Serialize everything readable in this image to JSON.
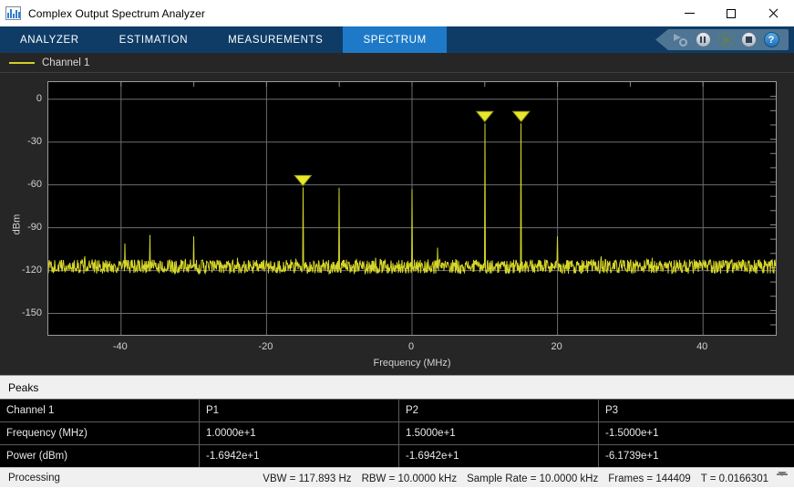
{
  "window": {
    "title": "Complex Output Spectrum Analyzer",
    "icon": "spectrum-bars-icon",
    "minimize_label": "Minimize",
    "maximize_label": "Maximize",
    "close_label": "Close"
  },
  "tabs": [
    {
      "label": "ANALYZER",
      "active": false
    },
    {
      "label": "ESTIMATION",
      "active": false
    },
    {
      "label": "MEASUREMENTS",
      "active": false
    },
    {
      "label": "SPECTRUM",
      "active": true
    }
  ],
  "toolbar": {
    "items": [
      {
        "name": "simulate-settings-icon",
        "label": "Simulation settings",
        "enabled": false
      },
      {
        "name": "pause-icon",
        "label": "Pause",
        "enabled": true
      },
      {
        "name": "play-icon",
        "label": "Run",
        "enabled": false
      },
      {
        "name": "stop-icon",
        "label": "Stop",
        "enabled": true
      },
      {
        "name": "help-icon",
        "label": "?",
        "enabled": true
      }
    ]
  },
  "legend": {
    "label": "Channel 1",
    "color": "#cfcf2e"
  },
  "chart_data": {
    "type": "line",
    "title": "",
    "xlabel": "Frequency (MHz)",
    "ylabel": "dBm",
    "xlim": [
      -50,
      50
    ],
    "ylim": [
      -165,
      12
    ],
    "xticks": [
      -40,
      -20,
      0,
      20,
      40
    ],
    "yticks": [
      0,
      -30,
      -60,
      -90,
      -120,
      -150
    ],
    "grid": true,
    "background": "#000000",
    "trace_color": "#d6d62a",
    "noise_floor_dbm": -118,
    "noise_ripple_db": 5,
    "series": [
      {
        "name": "Channel 1",
        "peaks": [
          {
            "freq_mhz": 10.0,
            "power_dbm": -16.942,
            "marker": true,
            "label": "P1"
          },
          {
            "freq_mhz": 15.0,
            "power_dbm": -16.942,
            "marker": true,
            "label": "P2"
          },
          {
            "freq_mhz": -15.0,
            "power_dbm": -61.739,
            "marker": true,
            "label": "P3"
          }
        ],
        "spurs": [
          {
            "freq_mhz": -45.0,
            "power_dbm": -110
          },
          {
            "freq_mhz": -39.5,
            "power_dbm": -101
          },
          {
            "freq_mhz": -36.0,
            "power_dbm": -95
          },
          {
            "freq_mhz": -30.0,
            "power_dbm": -96
          },
          {
            "freq_mhz": -24.0,
            "power_dbm": -111
          },
          {
            "freq_mhz": -10.0,
            "power_dbm": -62
          },
          {
            "freq_mhz": -5.0,
            "power_dbm": -111
          },
          {
            "freq_mhz": 0.0,
            "power_dbm": -63
          },
          {
            "freq_mhz": 3.5,
            "power_dbm": -104
          },
          {
            "freq_mhz": 6.0,
            "power_dbm": -112
          },
          {
            "freq_mhz": 20.0,
            "power_dbm": -96
          },
          {
            "freq_mhz": 26.0,
            "power_dbm": -110
          },
          {
            "freq_mhz": 33.0,
            "power_dbm": -111
          },
          {
            "freq_mhz": 44.0,
            "power_dbm": -112
          }
        ]
      }
    ]
  },
  "peaks_panel": {
    "title": "Peaks",
    "columns": [
      "Channel 1",
      "P1",
      "P2",
      "P3"
    ],
    "rows": [
      {
        "label": "Frequency (MHz)",
        "values": [
          "1.0000e+1",
          "1.5000e+1",
          "-1.5000e+1"
        ]
      },
      {
        "label": "Power (dBm)",
        "values": [
          "-1.6942e+1",
          "-1.6942e+1",
          "-6.1739e+1"
        ]
      }
    ]
  },
  "statusbar": {
    "state": "Processing",
    "metrics": [
      "VBW = 117.893 Hz",
      "RBW = 10.0000 kHz",
      "Sample Rate = 10.0000 kHz",
      "Frames = 144409",
      "T = 0.0166301"
    ],
    "grip": "resize-grip-icon"
  }
}
